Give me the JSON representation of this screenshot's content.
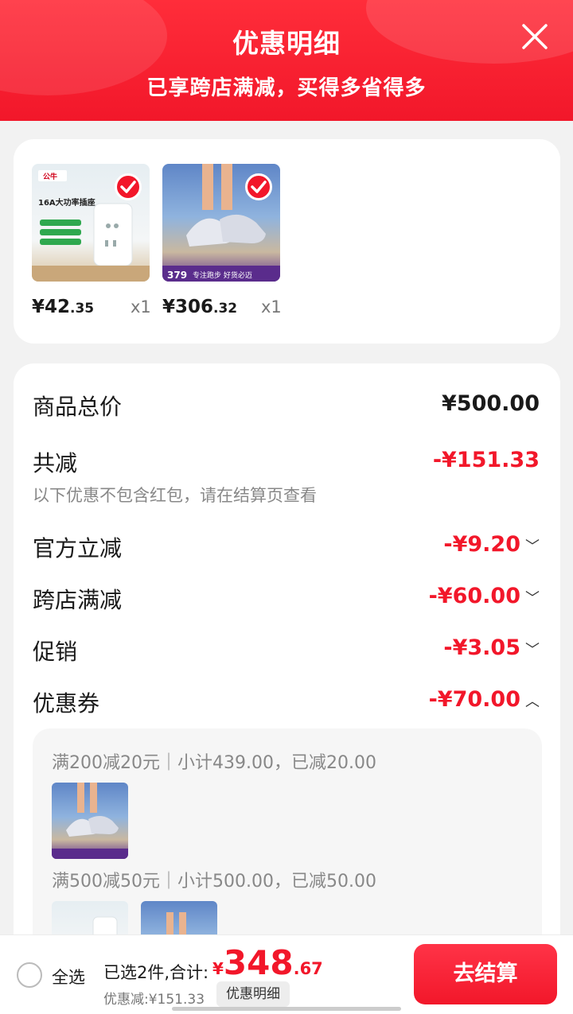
{
  "header": {
    "title": "优惠明细",
    "subtitle": "已享跨店满减，买得多省得多"
  },
  "products": [
    {
      "price_int": "¥42",
      "price_dec": ".35",
      "qty": "x1",
      "thumb_text": "16A大功率插座",
      "brand": "公牛"
    },
    {
      "price_int": "¥306",
      "price_dec": ".32",
      "qty": "x1",
      "thumb_text": "专注跑步 好货必迈",
      "badge": "379"
    }
  ],
  "summary": {
    "total_label": "商品总价",
    "total_value": "¥500.00",
    "reduced_label": "共减",
    "reduced_value": "-¥151.33",
    "note": "以下优惠不包含红包，请在结算页查看",
    "items": [
      {
        "label": "官方立减",
        "value": "-¥9.20",
        "chevron": "﹀"
      },
      {
        "label": "跨店满减",
        "value": "-¥60.00",
        "chevron": "﹀"
      },
      {
        "label": "促销",
        "value": "-¥3.05",
        "chevron": "﹀"
      },
      {
        "label": "优惠券",
        "value": "-¥70.00",
        "chevron": "︿"
      }
    ],
    "coupons": [
      "满200减20元｜小计439.00，已减20.00",
      "满500减50元｜小计500.00，已减50.00"
    ]
  },
  "bottom": {
    "select_all": "全选",
    "selected": "已选2件,合计:",
    "yen": "¥",
    "total_int": "348",
    "total_dec": ".67",
    "discount": "优惠减:¥151.33",
    "detail_button": "优惠明细",
    "checkout_button": "去结算"
  },
  "colors": {
    "accent": "#f2172a",
    "header_bg": "#ff2d3a"
  },
  "icons": {
    "close": "close-icon",
    "check": "check-icon"
  }
}
